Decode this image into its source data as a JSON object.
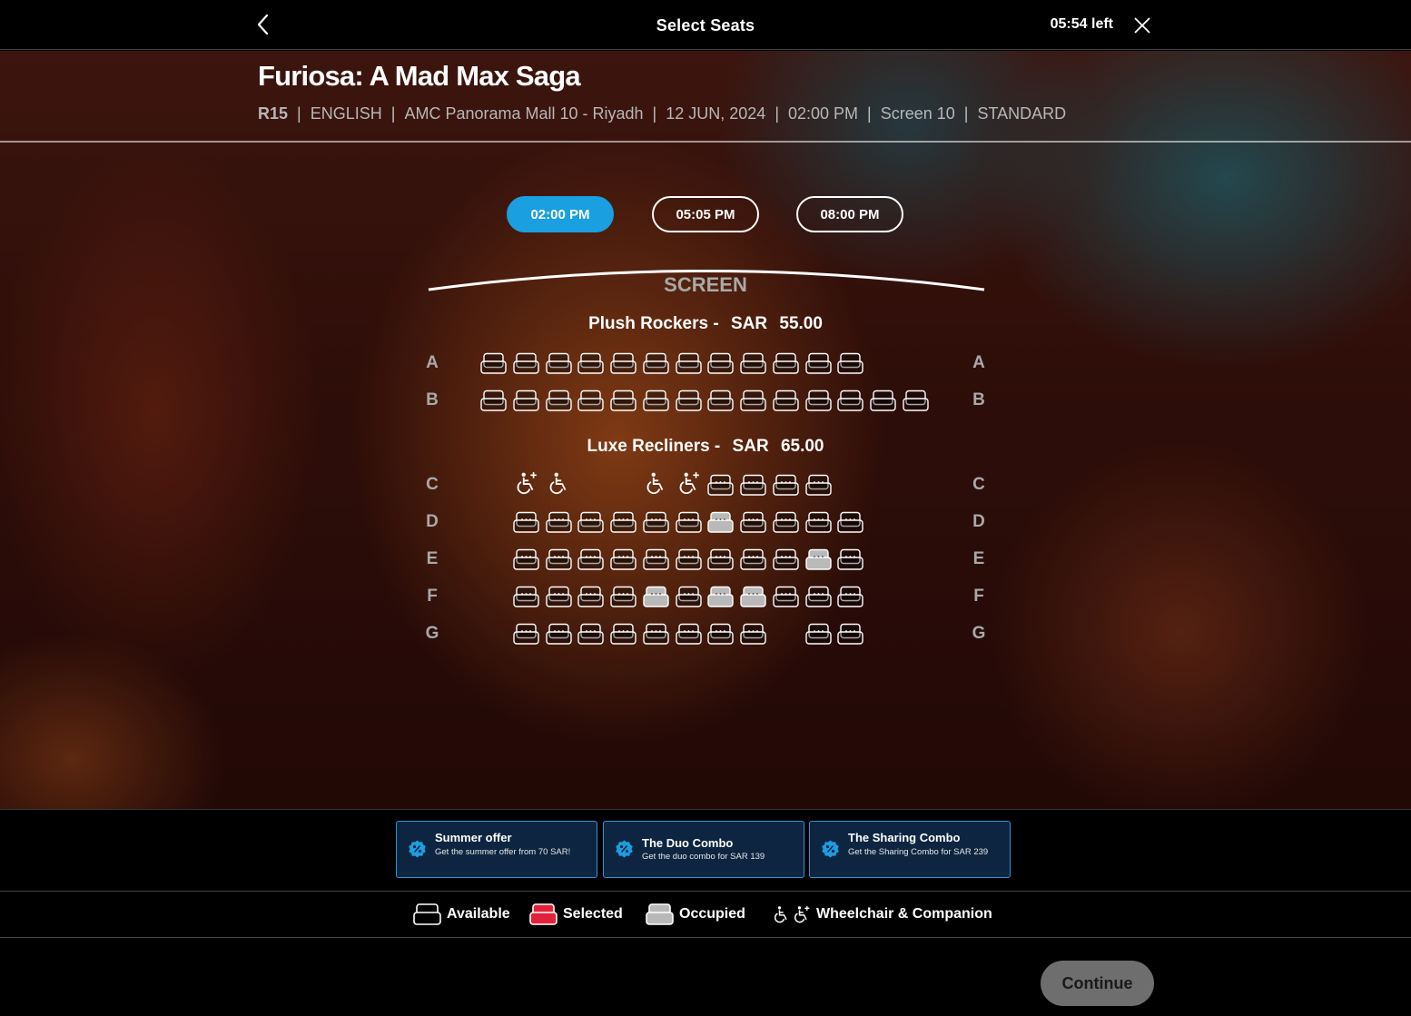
{
  "header": {
    "title": "Select Seats",
    "timer": "05:54 left"
  },
  "movie": {
    "title": "Furiosa: A Mad Max Saga",
    "rating": "R15",
    "language": "ENGLISH",
    "cinema": "AMC Panorama Mall 10 - Riyadh",
    "date": "12 JUN, 2024",
    "time": "02:00 PM",
    "screen": "Screen 10",
    "format": "STANDARD"
  },
  "showtimes": [
    {
      "label": "02:00 PM",
      "active": true
    },
    {
      "label": "05:05 PM",
      "active": false
    },
    {
      "label": "08:00 PM",
      "active": false
    }
  ],
  "screen_label": "SCREEN",
  "sections": [
    {
      "name": "Plush Rockers -",
      "currency": "SAR",
      "price": "55.00"
    },
    {
      "name": "Luxe Recliners -",
      "currency": "SAR",
      "price": "65.00"
    }
  ],
  "seat_rows": [
    {
      "row": "A",
      "type": "rocker",
      "seats": "AAAAAAAAAAAA"
    },
    {
      "row": "B",
      "type": "rocker",
      "seats": "AAAAAAAAAAAAAA"
    },
    {
      "row": "C",
      "type": "recliner",
      "seats": "_CW__WCAAAA"
    },
    {
      "row": "D",
      "type": "recliner",
      "seats": "_AAAAAAOAAAA"
    },
    {
      "row": "E",
      "type": "recliner",
      "seats": "_AAAAAAAAAOA"
    },
    {
      "row": "F",
      "type": "recliner",
      "seats": "_AAAAOAOOAAA"
    },
    {
      "row": "G",
      "type": "recliner",
      "seats": "_AAAAAAAA_AA"
    }
  ],
  "seat_legend_codes": {
    "A": "available",
    "O": "occupied",
    "S": "selected",
    "W": "wheelchair",
    "C": "companion",
    "_": "gap"
  },
  "offers": [
    {
      "title": "Summer offer",
      "description": "Get the summer offer from 70 SAR!"
    },
    {
      "title": "The Duo Combo",
      "description": "Get the duo combo for SAR 139"
    },
    {
      "title": "The Sharing Combo",
      "description": "Get the Sharing Combo for SAR 239"
    }
  ],
  "legend": {
    "available": "Available",
    "selected": "Selected",
    "occupied": "Occupied",
    "wheelchair": "Wheelchair & Companion"
  },
  "colors": {
    "accent": "#1a9fe0",
    "selected": "#e0233a",
    "occupied": "#b9b9b9",
    "offer_border": "#2f95d9"
  },
  "continue_label": "Continue"
}
